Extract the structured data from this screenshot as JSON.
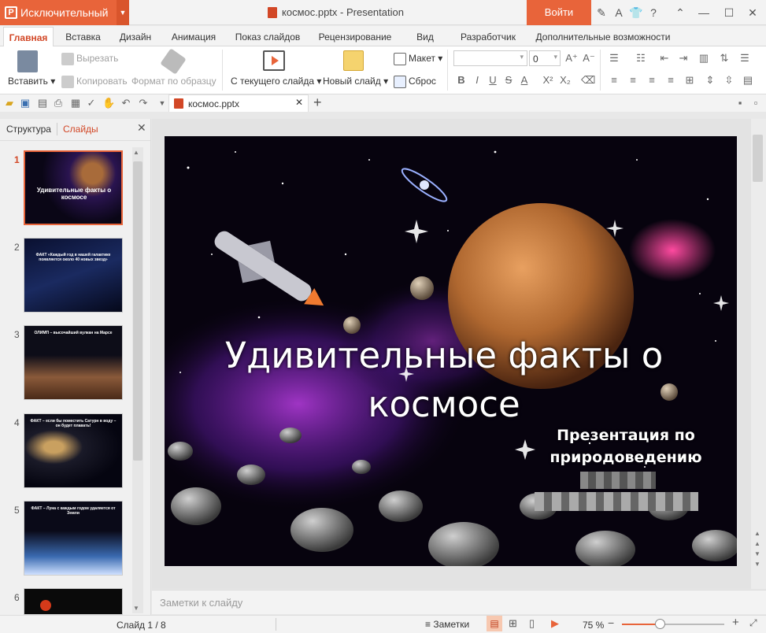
{
  "app": {
    "menu_label": "Исключительный",
    "doc_title": "космос.pptx - Presentation",
    "login_label": "Войти"
  },
  "tabs": [
    "Главная",
    "Вставка",
    "Дизайн",
    "Анимация",
    "Показ слайдов",
    "Рецензирование",
    "Вид",
    "Разработчик",
    "Дополнительные возможности"
  ],
  "ribbon": {
    "paste": "Вставить",
    "cut": "Вырезать",
    "copy": "Копировать",
    "format_painter": "Формат по образцу",
    "from_current": "С текущего слайда",
    "new_slide": "Новый слайд",
    "layout": "Макет",
    "reset": "Сброс",
    "font_size": "0"
  },
  "doc_tab": {
    "name": "космос.pptx"
  },
  "panel": {
    "structure_tab": "Структура",
    "slides_tab": "Слайды"
  },
  "slides": [
    {
      "num": "1",
      "text": "Удивительные факты о космосе"
    },
    {
      "num": "2",
      "text": "ФАКТ «Каждый год в нашей галактике появляется около 40 новых звезд»"
    },
    {
      "num": "3",
      "text": "ОЛИМП – высочайший вулкан на Марсе"
    },
    {
      "num": "4",
      "text": "ФАКТ – если бы поместить Сатурн в воду – он будет плавать!"
    },
    {
      "num": "5",
      "text": "ФАКТ – Луна с каждым годом удаляется от Земли"
    },
    {
      "num": "6",
      "text": ""
    }
  ],
  "main_slide": {
    "title": "Удивительные факты о космосе",
    "subtitle_line1": "Презентация по",
    "subtitle_line2": "природоведению"
  },
  "notes_placeholder": "Заметки к слайду",
  "status": {
    "slide_counter": "Слайд 1 / 8",
    "notes_label": "Заметки",
    "zoom": "75 %"
  },
  "colors": {
    "accent": "#e8643a",
    "active_tab": "#d24726"
  }
}
